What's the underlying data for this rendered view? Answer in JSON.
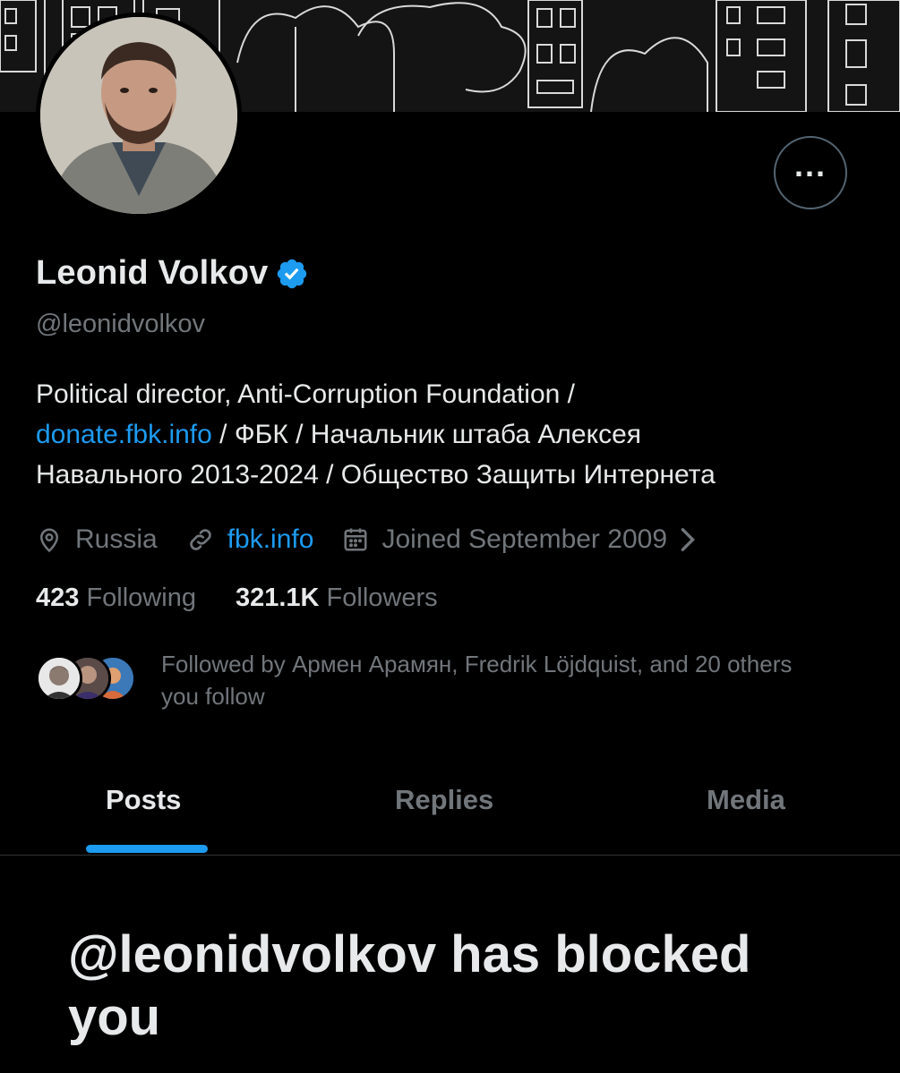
{
  "profile": {
    "name": "Leonid Volkov",
    "handle": "@leonidvolkov",
    "bio_line1": "Political director, Anti-Corruption Foundation /",
    "bio_link": "donate.fbk.info",
    "bio_line2_rest": " / ФБК / Начальник штаба Алексея",
    "bio_line3": "Навального 2013-2024 / Общество Защиты Интернета",
    "location": "Russia",
    "website": "fbk.info",
    "joined": "Joined September 2009",
    "following_count": "423",
    "following_label": "Following",
    "followers_count": "321.1K",
    "followers_label": "Followers",
    "followed_by": "Followed by Армен Арамян, Fredrik Löjdquist, and 20 others you follow"
  },
  "tabs": [
    "Posts",
    "Replies",
    "Media"
  ],
  "active_tab": "Posts",
  "blocked_message": "@leonidvolkov has blocked you",
  "colors": {
    "background": "#000000",
    "text": "#e7e9ea",
    "muted": "#71767b",
    "accent": "#1d9bf0",
    "border": "#2f3336"
  },
  "icons": [
    "verified-badge-icon",
    "more-icon",
    "location-icon",
    "link-icon",
    "calendar-icon",
    "chevron-right-icon"
  ]
}
